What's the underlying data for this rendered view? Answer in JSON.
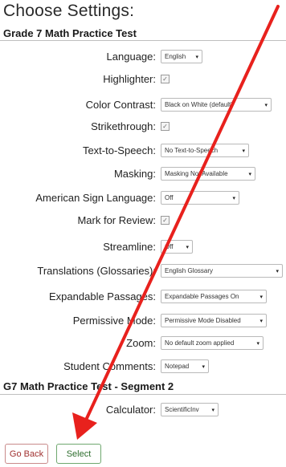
{
  "page_title": "Choose Settings:",
  "test_title": "Grade 7 Math Practice Test",
  "segment_title": "G7 Math Practice Test - Segment 2",
  "settings": [
    {
      "label": "Language:",
      "type": "select",
      "value": "English"
    },
    {
      "label": "Highlighter:",
      "type": "checkbox",
      "value": "checked"
    },
    {
      "label": "Color Contrast:",
      "type": "select",
      "value": "Black on White (default)"
    },
    {
      "label": "Strikethrough:",
      "type": "checkbox",
      "value": "checked"
    },
    {
      "label": "Text-to-Speech:",
      "type": "select",
      "value": "No Text-to-Speech"
    },
    {
      "label": "Masking:",
      "type": "select",
      "value": "Masking Not Available"
    },
    {
      "label": "American Sign Language:",
      "type": "select",
      "value": "Off"
    },
    {
      "label": "Mark for Review:",
      "type": "checkbox",
      "value": "checked"
    },
    {
      "label": "Streamline:",
      "type": "select",
      "value": "Off"
    },
    {
      "label": "Translations (Glossaries):",
      "type": "select",
      "value": "English Glossary"
    },
    {
      "label": "Expandable Passages:",
      "type": "select",
      "value": "Expandable Passages On"
    },
    {
      "label": "Permissive Mode:",
      "type": "select",
      "value": "Permissive Mode Disabled"
    },
    {
      "label": "Zoom:",
      "type": "select",
      "value": "No default zoom applied"
    },
    {
      "label": "Student Comments:",
      "type": "select",
      "value": "Notepad"
    }
  ],
  "segment_settings": [
    {
      "label": "Calculator:",
      "type": "select",
      "value": "ScientificInv"
    }
  ],
  "buttons": {
    "back": "Go Back",
    "select": "Select"
  },
  "colors": {
    "annotation_arrow": "#e8211d",
    "back_button": "#a0302f",
    "select_button": "#2e6e2e"
  },
  "icons": {
    "checkbox_mark": "✓",
    "dropdown": "▾"
  }
}
